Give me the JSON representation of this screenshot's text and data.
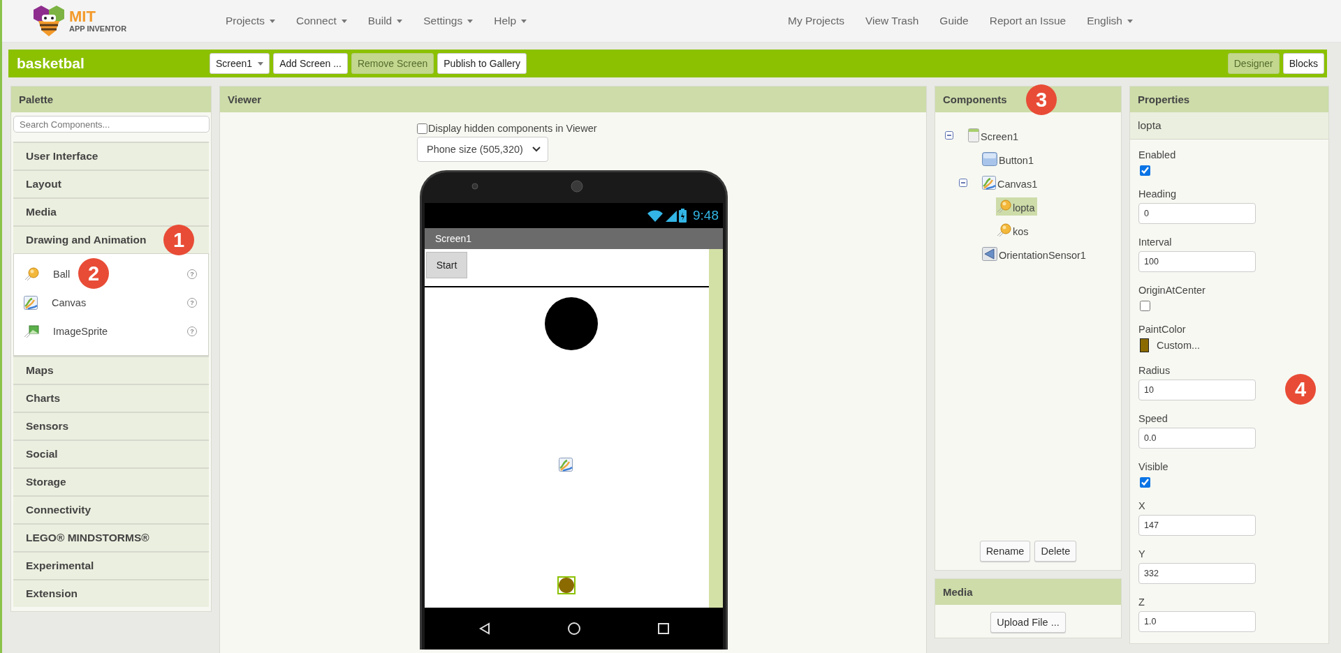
{
  "logo": {
    "line1": "MIT",
    "line2": "APP INVENTOR"
  },
  "top_menu": [
    {
      "label": "Projects",
      "dropdown": true
    },
    {
      "label": "Connect",
      "dropdown": true
    },
    {
      "label": "Build",
      "dropdown": true
    },
    {
      "label": "Settings",
      "dropdown": true
    },
    {
      "label": "Help",
      "dropdown": true
    }
  ],
  "top_links": [
    {
      "label": "My Projects",
      "dropdown": false
    },
    {
      "label": "View Trash",
      "dropdown": false
    },
    {
      "label": "Guide",
      "dropdown": false
    },
    {
      "label": "Report an Issue",
      "dropdown": false
    },
    {
      "label": "English",
      "dropdown": true
    }
  ],
  "toolbar": {
    "project_name": "basketbal",
    "buttons": [
      {
        "label": "Screen1",
        "dropdown": true,
        "disabled": false
      },
      {
        "label": "Add Screen ...",
        "dropdown": false,
        "disabled": false
      },
      {
        "label": "Remove Screen",
        "dropdown": false,
        "disabled": true
      },
      {
        "label": "Publish to Gallery",
        "dropdown": false,
        "disabled": false
      }
    ],
    "view_buttons": [
      {
        "label": "Designer",
        "selected": true
      },
      {
        "label": "Blocks",
        "selected": false
      }
    ]
  },
  "palette": {
    "title": "Palette",
    "search": {
      "placeholder": "Search Components..."
    },
    "categories": [
      {
        "label": "User Interface"
      },
      {
        "label": "Layout"
      },
      {
        "label": "Media"
      },
      {
        "label": "Drawing and Animation",
        "marker": "1",
        "items": [
          {
            "label": "Ball",
            "kind": "ball",
            "help": "?",
            "marker": "2"
          },
          {
            "label": "Canvas",
            "kind": "canvas",
            "help": "?"
          },
          {
            "label": "ImageSprite",
            "kind": "sprite",
            "help": "?"
          }
        ]
      },
      {
        "label": "Maps"
      },
      {
        "label": "Charts"
      },
      {
        "label": "Sensors"
      },
      {
        "label": "Social"
      },
      {
        "label": "Storage"
      },
      {
        "label": "Connectivity"
      },
      {
        "label": "LEGO® MINDSTORMS®"
      },
      {
        "label": "Experimental"
      },
      {
        "label": "Extension"
      }
    ]
  },
  "viewer": {
    "title": "Viewer",
    "show_hidden": {
      "label": "Display hidden components in Viewer",
      "checked": false
    },
    "size_select": "Phone size (505,320)",
    "phone": {
      "time": "9:48",
      "screen_title": "Screen1",
      "button": "Start"
    }
  },
  "components": {
    "title": "Components",
    "marker": "3",
    "tree": [
      {
        "label": "Screen1",
        "kind": "screen",
        "expanded": true,
        "selected": false,
        "children": [
          {
            "label": "Button1",
            "kind": "button",
            "selected": false
          },
          {
            "label": "Canvas1",
            "kind": "canvas",
            "expanded": true,
            "selected": false,
            "children": [
              {
                "label": "lopta",
                "kind": "ball",
                "selected": true
              },
              {
                "label": "kos",
                "kind": "ball",
                "selected": false
              }
            ]
          },
          {
            "label": "OrientationSensor1",
            "kind": "sensor",
            "selected": false
          }
        ]
      }
    ],
    "buttons": [
      "Rename",
      "Delete"
    ]
  },
  "media": {
    "title": "Media",
    "button": "Upload File ..."
  },
  "properties": {
    "title": "Properties",
    "component": "lopta",
    "items": [
      {
        "kind": "checkbox",
        "label": "Enabled",
        "checked": true
      },
      {
        "kind": "text",
        "label": "Heading",
        "value": "0"
      },
      {
        "kind": "text",
        "label": "Interval",
        "value": "100"
      },
      {
        "kind": "checkbox",
        "label": "OriginAtCenter",
        "checked": false
      },
      {
        "kind": "color",
        "label": "PaintColor",
        "color": "#8b6a00",
        "value": "Custom..."
      },
      {
        "kind": "text",
        "label": "Radius",
        "value": "10",
        "marker": "4"
      },
      {
        "kind": "text",
        "label": "Speed",
        "value": "0.0"
      },
      {
        "kind": "checkbox",
        "label": "Visible",
        "checked": true
      },
      {
        "kind": "text",
        "label": "X",
        "value": "147"
      },
      {
        "kind": "text",
        "label": "Y",
        "value": "332"
      },
      {
        "kind": "text",
        "label": "Z",
        "value": "1.0"
      }
    ]
  }
}
